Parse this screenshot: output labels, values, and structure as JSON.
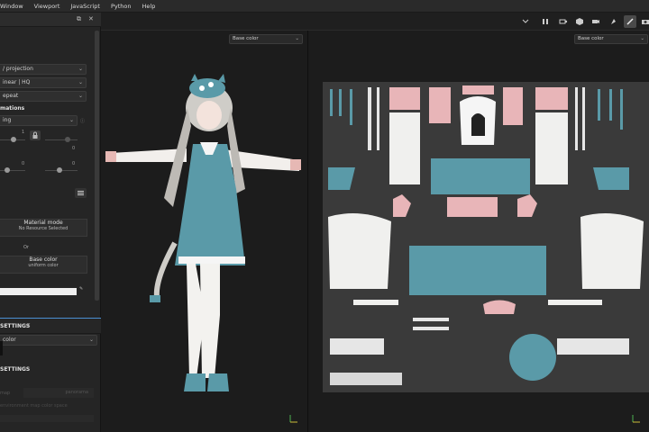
{
  "menu": {
    "items": [
      "Window",
      "Viewport",
      "JavaScript",
      "Python",
      "Help"
    ]
  },
  "toolbar": {
    "icons": [
      "pause-icon",
      "capture-icon",
      "cube-icon",
      "video-icon",
      "paint-icon",
      "brush-icon",
      "camera-icon"
    ]
  },
  "left_panel": {
    "projection_value": "/ projection",
    "filtering_value": "inear | HQ",
    "tiling_value": "epeat",
    "section_label": "mations",
    "mode_value": "ing",
    "slider_value_a": "1",
    "slider_value_b": "0",
    "slider_value_c": "0",
    "slider_value_d": "0",
    "material_mode_title": "Material mode",
    "material_mode_sub": "No Resource Selected",
    "or_label": "Or",
    "base_color_title": "Base color",
    "base_color_sub": "uniform color",
    "settings_tab_label": "SETTINGS",
    "settings_color_value": "color",
    "settings_section_label": "SETTINGS",
    "faded_row_label": "map",
    "faded_row_value": "panorama",
    "faded_row2_label": "environment map color space"
  },
  "viewport_left": {
    "channel_value": "Base color"
  },
  "viewport_right": {
    "channel_value": "Base color"
  },
  "colors": {
    "accent": "#4a8fd3",
    "teal": "#5a9aa8",
    "pink": "#e8b5b8",
    "white": "#ecebe8"
  }
}
